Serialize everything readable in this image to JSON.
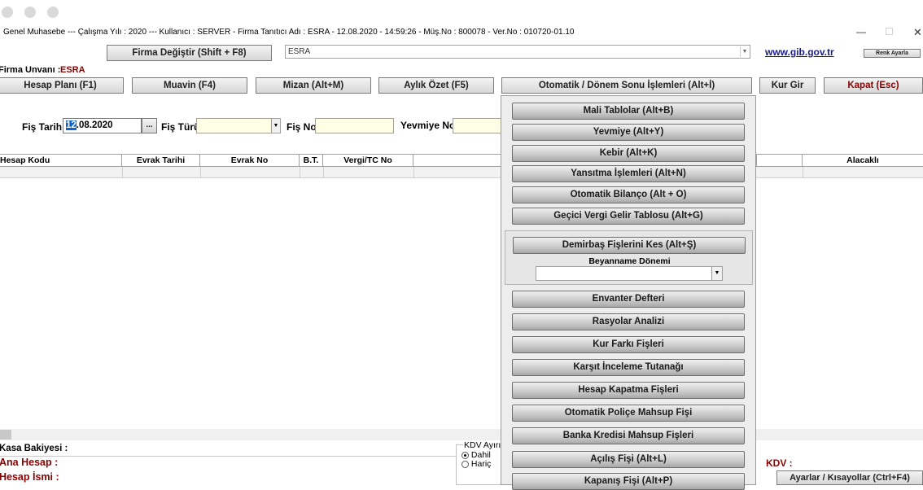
{
  "window": {
    "info_line": "Genel Muhasebe  ---  Çalışma Yılı : 2020  ---  Kullanıcı : SERVER - Firma Tanıtıcı Adı : ESRA - 12.08.2020 - 14:59:26 - Müş.No : 800078 - Ver.No : 010720-01.10",
    "minimize": "—",
    "maximize": "☐",
    "close": "✕"
  },
  "toprow": {
    "firma_degistir": "Firma Değiştir (Shift + F8)",
    "company_select": "ESRA",
    "gib_link": "www.gib.gov.tr",
    "renk_ayarla": "Renk Ayarla"
  },
  "firma": {
    "label": "Firma Unvanı :",
    "value": "ESRA"
  },
  "menu": {
    "hesap_plani": "Hesap Planı (F1)",
    "muavin": "Muavin (F4)",
    "mizan": "Mizan (Alt+M)",
    "aylik_ozet": "Aylık Özet (F5)",
    "otomatik": "Otomatik / Dönem Sonu İşlemleri (Alt+İ)",
    "kur_gir": "Kur Gir",
    "kapat": "Kapat (Esc)"
  },
  "form": {
    "fis_tarihi_label": "Fiş Tarihi",
    "fis_tarihi_value": "12.08.2020",
    "fis_tarihi_sel": "12",
    "fis_tarihi_rest": ".08.2020",
    "ellipsis": "...",
    "fis_turu_label": "Fiş Türü",
    "fis_no_label": "Fiş No",
    "yevmiye_no_label": "Yevmiye No"
  },
  "table": {
    "columns": [
      "Hesap Kodu",
      "Evrak Tarihi",
      "Evrak No",
      "B.T.",
      "Vergi/TC No",
      "Alacaklı"
    ]
  },
  "dropdown_panel": {
    "group1": [
      "Mali Tablolar (Alt+B)",
      "Yevmiye (Alt+Y)",
      "Kebir (Alt+K)",
      "Yansıtma İşlemleri (Alt+N)",
      "Otomatik Bilanço (Alt + O)",
      "Geçici Vergi Gelir Tablosu (Alt+G)"
    ],
    "demirbas": "Demirbaş Fişlerini Kes (Alt+Ş)",
    "beyanname_label": "Beyanname Dönemi",
    "group2": [
      "Envanter Defteri",
      "Rasyolar Analizi",
      "Kur Farkı Fişleri",
      "Karşıt İnceleme Tutanağı",
      "Hesap Kapatma Fişleri",
      "Otomatik Poliçe Mahsup Fişi",
      "Banka Kredisi Mahsup Fişleri",
      "Açılış Fişi (Alt+L)",
      "Kapanış Fişi (Alt+P)"
    ]
  },
  "bottom": {
    "kasa_bakiyesi": "Kasa Bakiyesi :",
    "ana_hesap": "Ana Hesap :",
    "hesap_ismi": "Hesap İsmi :",
    "kdv_group": "KDV Ayırı",
    "dahil": "Dahil",
    "haric": "Hariç",
    "kdv_label": "KDV :",
    "ayarlar": "Ayarlar / Kısayollar (Ctrl+F4)"
  },
  "colors": {
    "dark_red": "#8b0000",
    "link_blue": "#1a1a8c",
    "selection_blue": "#0a64d6"
  }
}
